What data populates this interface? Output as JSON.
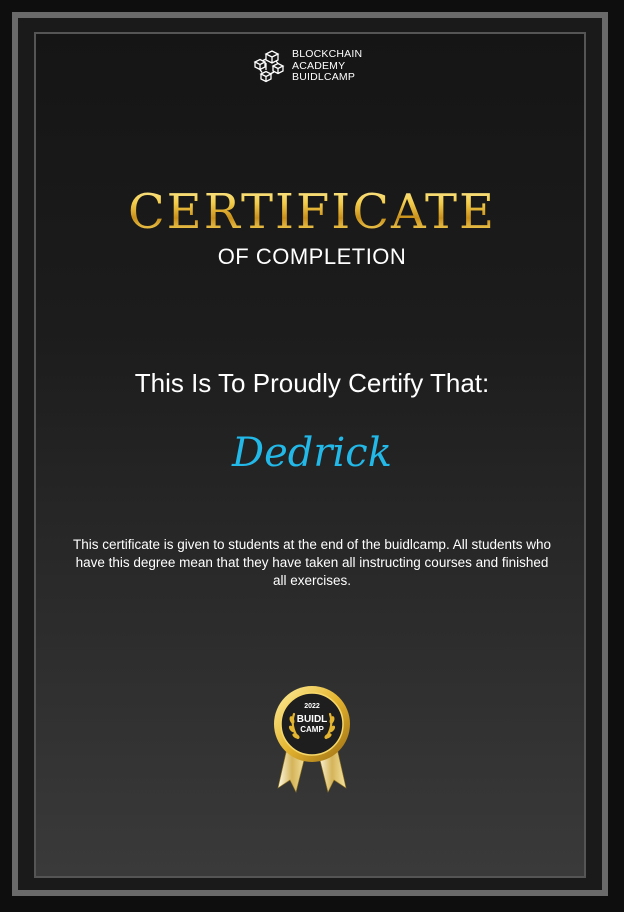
{
  "logo": {
    "icon": "blockchain-cubes-icon",
    "lines": [
      "BLOCKCHAIN",
      "ACADEMY",
      "BUIDLCAMP"
    ]
  },
  "certificate": {
    "title": "CERTIFICATE",
    "subtitle": "OF COMPLETION",
    "certify_line": "This Is To Proudly Certify That:",
    "recipient": "Dedrick",
    "description": "This certificate is given to students at the end of the  buidlcamp. All students who have this degree mean that they have taken all instructing courses and finished all exercises."
  },
  "badge": {
    "icon": "award-rosette-icon",
    "year": "2022",
    "line1": "BUIDL",
    "line2": "CAMP"
  },
  "colors": {
    "gold": "#e8b830",
    "recipient": "#22b8e8",
    "background": "#1a1a1a",
    "frame": "#6a6a6a"
  }
}
